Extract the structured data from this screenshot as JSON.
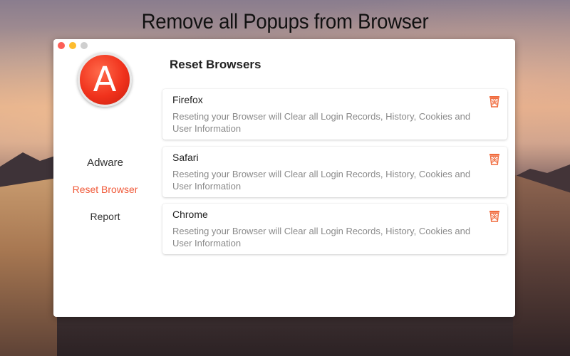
{
  "headline": "Remove all Popups from Browser",
  "window": {
    "traffic_lights": [
      "close",
      "minimize",
      "zoom-disabled"
    ]
  },
  "logo": {
    "letter": "A"
  },
  "sidebar": {
    "items": [
      {
        "label": "Adware",
        "active": false
      },
      {
        "label": "Reset Browser",
        "active": true
      },
      {
        "label": "Report",
        "active": false
      }
    ]
  },
  "main": {
    "title": "Reset Browsers",
    "browsers": [
      {
        "name": "Firefox",
        "description": "Reseting your Browser will Clear all Login Records, History, Cookies and User Information",
        "action_icon": "trash-icon"
      },
      {
        "name": "Safari",
        "description": "Reseting your Browser will Clear all Login Records, History, Cookies and User Information",
        "action_icon": "trash-icon"
      },
      {
        "name": "Chrome",
        "description": "Reseting your Browser will Clear all Login Records, History, Cookies and User Information",
        "action_icon": "trash-icon"
      }
    ]
  },
  "colors": {
    "accent": "#f05a3a",
    "logo_red": "#f0321c",
    "trash_orange": "#f06a3c"
  }
}
